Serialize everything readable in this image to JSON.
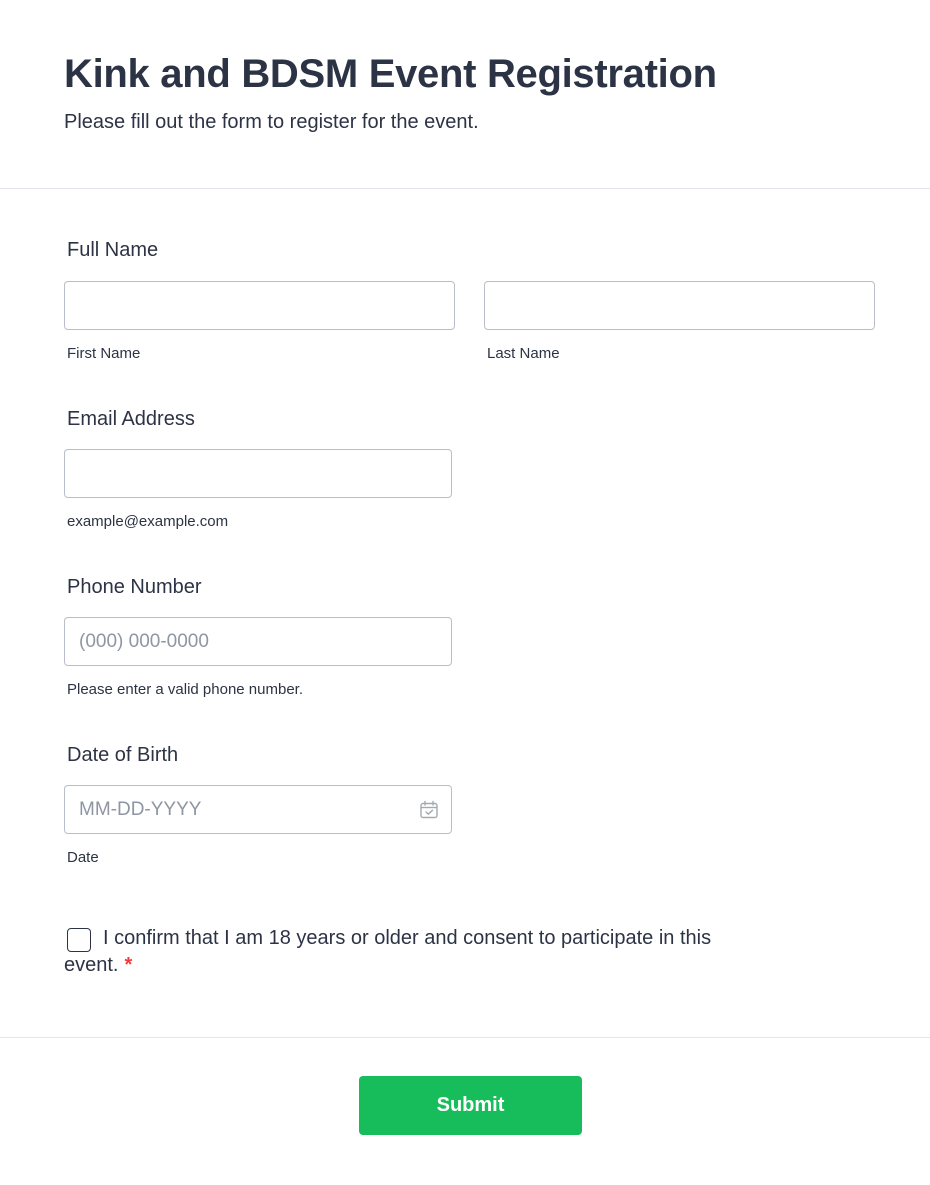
{
  "header": {
    "title": "Kink and BDSM Event Registration",
    "subtitle": "Please fill out the form to register for the event."
  },
  "full_name": {
    "label": "Full Name",
    "first_value": "",
    "first_sublabel": "First Name",
    "last_value": "",
    "last_sublabel": "Last Name"
  },
  "email": {
    "label": "Email Address",
    "value": "",
    "sublabel": "example@example.com"
  },
  "phone": {
    "label": "Phone Number",
    "placeholder": "(000) 000-0000",
    "sublabel": "Please enter a valid phone number."
  },
  "dob": {
    "label": "Date of Birth",
    "placeholder": "MM-DD-YYYY",
    "sublabel": "Date",
    "icon": "calendar-icon"
  },
  "consent": {
    "line1": "I confirm that I am 18 years or older and consent to participate in this",
    "line2": "event.",
    "required_mark": "*",
    "checked": false
  },
  "submit": {
    "label": "Submit"
  },
  "colors": {
    "text": "#2c3345",
    "border": "#b8bdc9",
    "submit": "#18bd5b",
    "required": "#f23a3c"
  }
}
